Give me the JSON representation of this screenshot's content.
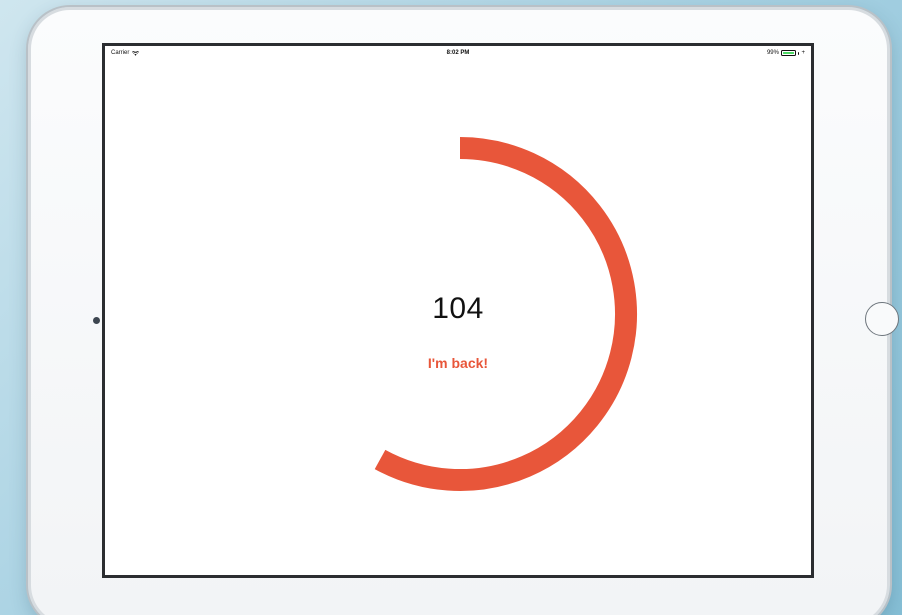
{
  "status_bar": {
    "carrier": "Carrier",
    "time": "8:02 PM",
    "battery_percent": "99%",
    "battery_level": 0.99,
    "wifi_icon": "wifi-icon",
    "charging_icon": "charging-icon"
  },
  "timer": {
    "value": "104",
    "message": "I'm back!",
    "progress_fraction": 0.58
  },
  "colors": {
    "accent": "#e8563a",
    "battery_green": "#4cd964"
  }
}
